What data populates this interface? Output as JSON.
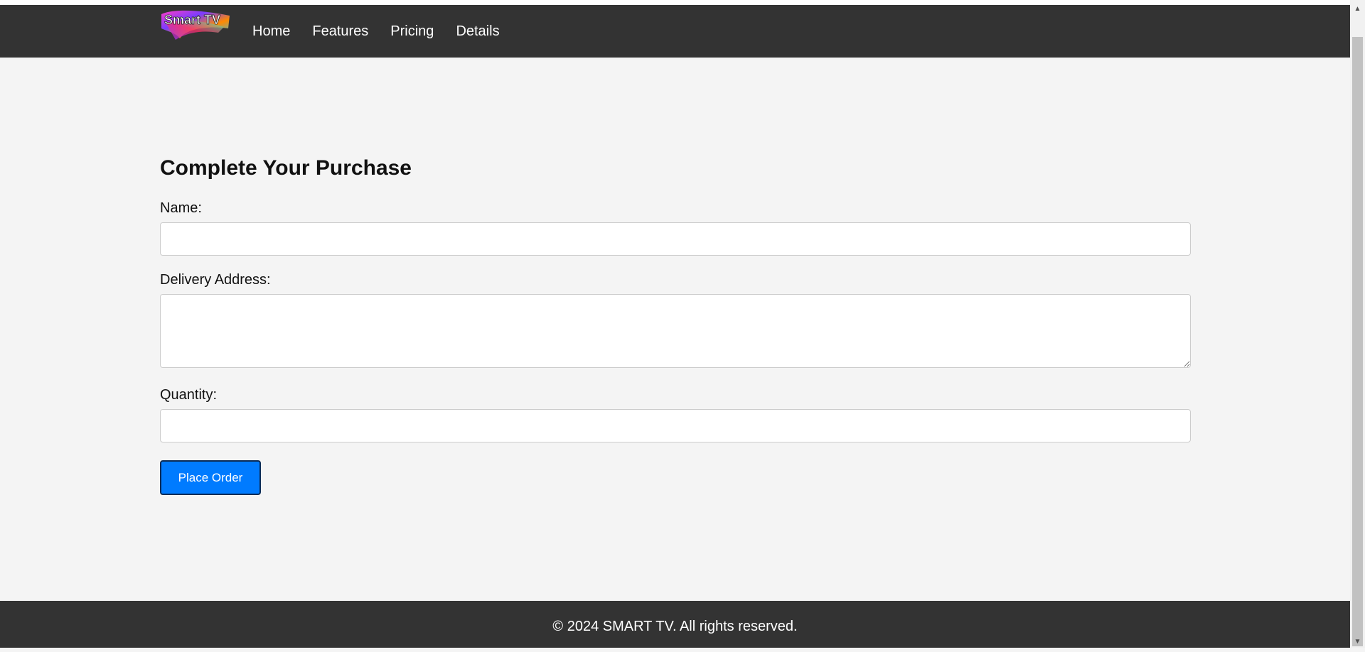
{
  "brand": {
    "logo_text": "Smart TV"
  },
  "nav": {
    "items": [
      "Home",
      "Features",
      "Pricing",
      "Details"
    ]
  },
  "form": {
    "title": "Complete Your Purchase",
    "name_label": "Name:",
    "name_value": "",
    "address_label": "Delivery Address:",
    "address_value": "",
    "quantity_label": "Quantity:",
    "quantity_value": "",
    "submit_label": "Place Order"
  },
  "footer": {
    "text": "© 2024 SMART TV. All rights reserved."
  },
  "colors": {
    "header_bg": "#333333",
    "page_bg": "#f4f4f4",
    "button_bg": "#007bff"
  }
}
